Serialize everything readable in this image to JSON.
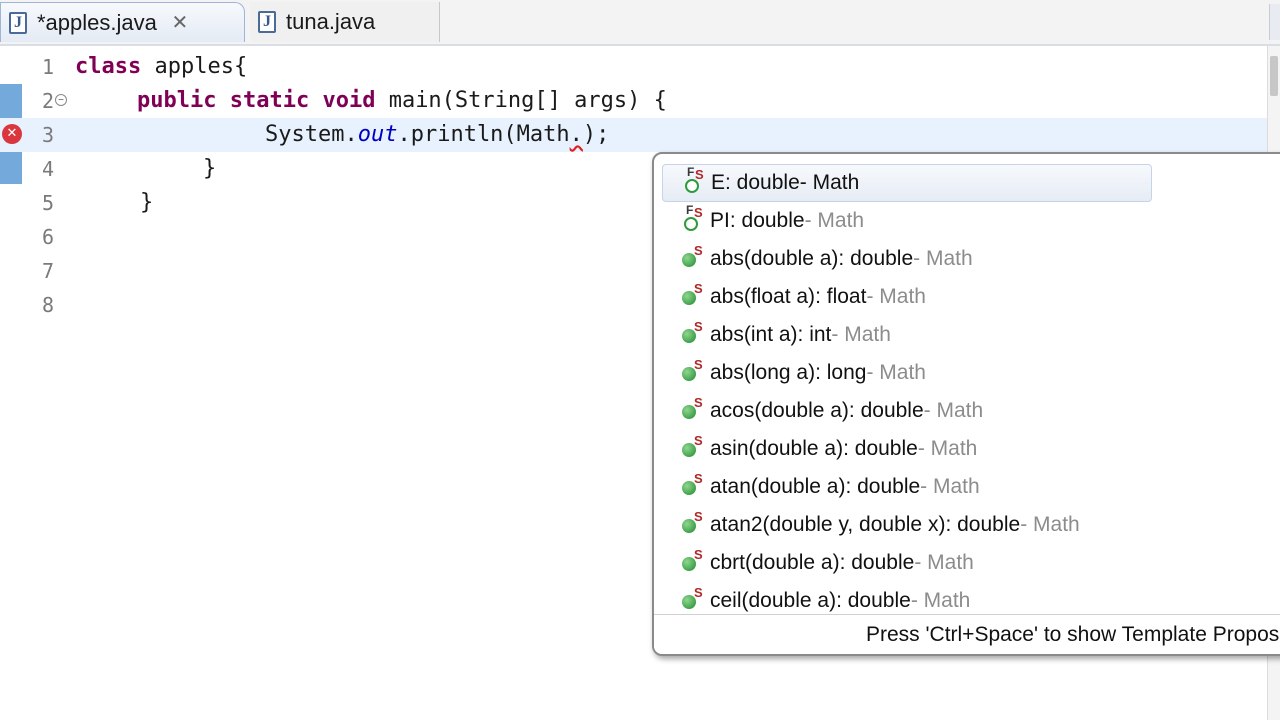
{
  "tabs": [
    {
      "label": "*apples.java",
      "active": true,
      "icon": "java-file-icon"
    },
    {
      "label": "tuna.java",
      "active": false,
      "icon": "java-file-icon"
    }
  ],
  "tab_close_glyph": "✕",
  "editor": {
    "lines": [
      {
        "num": "1",
        "text": "class apples{"
      },
      {
        "num": "2",
        "text": "public static void main(String[] args) {"
      },
      {
        "num": "3",
        "text": "System.out.println(Math.);"
      },
      {
        "num": "4",
        "text": "}"
      },
      {
        "num": "5",
        "text": "}"
      },
      {
        "num": "6",
        "text": ""
      },
      {
        "num": "7",
        "text": ""
      },
      {
        "num": "8",
        "text": ""
      }
    ],
    "error_line": "3",
    "error_glyph": "✕",
    "fold_glyph": "−"
  },
  "content_assist": {
    "proposals": [
      {
        "name": "E",
        "type": " : double",
        "owner": " - Math",
        "icon": "public-static-final-field-icon",
        "selected": true
      },
      {
        "name": "PI",
        "type": " : double",
        "owner": " - Math",
        "icon": "public-static-final-field-icon",
        "selected": false
      },
      {
        "name": "abs(double a)",
        "type": " : double",
        "owner": " - Math",
        "icon": "public-static-method-icon",
        "selected": false
      },
      {
        "name": "abs(float a)",
        "type": " : float",
        "owner": " - Math",
        "icon": "public-static-method-icon",
        "selected": false
      },
      {
        "name": "abs(int a)",
        "type": " : int",
        "owner": " - Math",
        "icon": "public-static-method-icon",
        "selected": false
      },
      {
        "name": "abs(long a)",
        "type": " : long",
        "owner": " - Math",
        "icon": "public-static-method-icon",
        "selected": false
      },
      {
        "name": "acos(double a)",
        "type": " : double",
        "owner": " - Math",
        "icon": "public-static-method-icon",
        "selected": false
      },
      {
        "name": "asin(double a)",
        "type": " : double",
        "owner": " - Math",
        "icon": "public-static-method-icon",
        "selected": false
      },
      {
        "name": "atan(double a)",
        "type": " : double",
        "owner": " - Math",
        "icon": "public-static-method-icon",
        "selected": false
      },
      {
        "name": "atan2(double y, double x)",
        "type": " : double",
        "owner": " - Math",
        "icon": "public-static-method-icon",
        "selected": false
      },
      {
        "name": "cbrt(double a)",
        "type": " : double",
        "owner": " - Math",
        "icon": "public-static-method-icon",
        "selected": false
      },
      {
        "name": "ceil(double a)",
        "type": " : double",
        "owner": " - Math",
        "icon": "public-static-method-icon",
        "selected": false
      }
    ],
    "status": "Press 'Ctrl+Space' to show Template Proposals",
    "static_marker": "S",
    "final_marker": "F"
  }
}
